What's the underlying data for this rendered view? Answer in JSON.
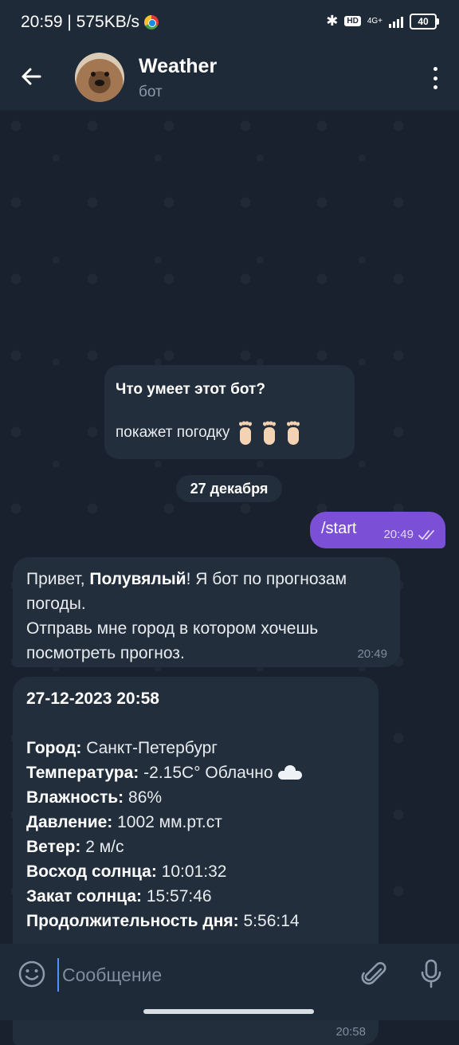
{
  "status_bar": {
    "time_speed": "20:59 | 575KB/s",
    "hd": "HD",
    "network": "4G+",
    "battery": "40"
  },
  "header": {
    "title": "Weather",
    "subtitle": "бот"
  },
  "bot_info": {
    "title": "Что умеет этот бот?",
    "description": "покажет погодку"
  },
  "date_separator": "27 декабря",
  "outgoing": {
    "text": "/start",
    "time": "20:49"
  },
  "greeting": {
    "prefix": "Привет, ",
    "name": "Полувялый",
    "line1_rest": "! Я бот по прогнозам",
    "line2": "погоды.",
    "line3": "Отправь мне город в котором хочешь",
    "line4": "посмотреть прогноз.",
    "time": "20:49"
  },
  "weather": {
    "datetime": "27-12-2023 20:58",
    "rows": [
      {
        "label": "Город:",
        "value": " Санкт-Петербург"
      },
      {
        "label": "Температура:",
        "value": " -2.15C° Облачно"
      },
      {
        "label": "Влажность:",
        "value": " 86%"
      },
      {
        "label": "Давление:",
        "value": " 1002 мм.рт.ст"
      },
      {
        "label": "Ветер:",
        "value": " 2 м/с"
      },
      {
        "label": "Восход солнца:",
        "value": " 10:01:32"
      },
      {
        "label": "Закат солнца:",
        "value": " 15:57:46"
      },
      {
        "label": "Продолжительность дня:",
        "value": " 5:56:14"
      }
    ],
    "time": "20:58"
  },
  "composer": {
    "placeholder": "Сообщение"
  },
  "colors": {
    "background": "#18212d",
    "header": "#1f2a38",
    "bubble_in": "#222e3b",
    "bubble_out": "#7b4fd6"
  }
}
